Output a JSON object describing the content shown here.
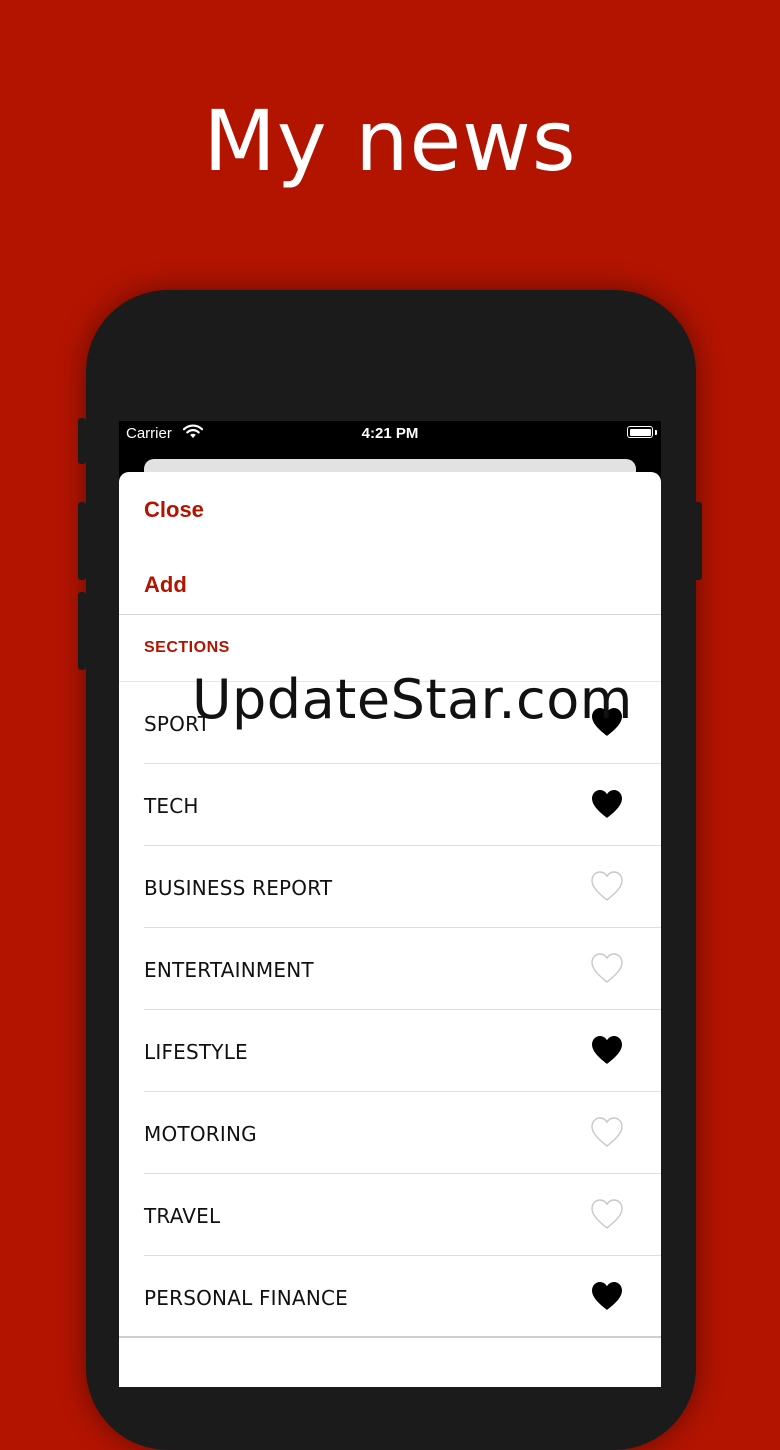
{
  "headline": "My news",
  "status_bar": {
    "carrier": "Carrier",
    "time": "4:21 PM"
  },
  "sheet": {
    "close_label": "Close",
    "add_label": "Add",
    "section_header": "SECTIONS"
  },
  "sections": [
    {
      "label": "SPORT",
      "favorited": true
    },
    {
      "label": "TECH",
      "favorited": true
    },
    {
      "label": "BUSINESS REPORT",
      "favorited": false
    },
    {
      "label": "ENTERTAINMENT",
      "favorited": false
    },
    {
      "label": "LIFESTYLE",
      "favorited": true
    },
    {
      "label": "MOTORING",
      "favorited": false
    },
    {
      "label": "TRAVEL",
      "favorited": false
    },
    {
      "label": "PERSONAL FINANCE",
      "favorited": true
    }
  ],
  "watermark": "UpdateStar.com",
  "colors": {
    "brand_red": "#b31400",
    "heart_filled": "#000000",
    "heart_outline": "#c8c8c8"
  },
  "icons": {
    "filled": "heart-filled-icon",
    "outline": "heart-outline-icon"
  }
}
